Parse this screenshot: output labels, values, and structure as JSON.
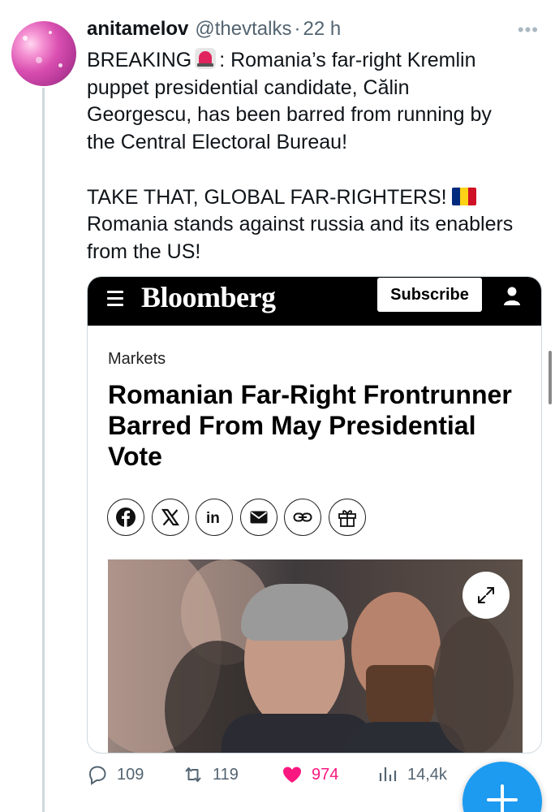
{
  "tweet": {
    "author_name": "anitamelov",
    "author_handle": "@thevtalks",
    "separator": "·",
    "time": "22 h",
    "more_icon": "more-horizontal-icon",
    "text_line1_a": "BREAKING",
    "text_line1_b": ": Romania’s far-right Kremlin",
    "text_line2": "puppet presidential candidate, Călin",
    "text_line3": "Georgescu, has been barred from running by",
    "text_line4": "the Central Electoral Bureau!",
    "text_line5": "TAKE THAT, GLOBAL FAR-RIGHTERS!",
    "text_line6": "Romania stands against russia and its enablers",
    "text_line7": "from the US!",
    "emoji_1": "siren-emoji",
    "emoji_2": "romania-flag-emoji",
    "flag_colors": [
      "#002b7f",
      "#fcd116",
      "#ce1126"
    ]
  },
  "card": {
    "brand": "Bloomberg",
    "subscribe_label": "Subscribe",
    "section": "Markets",
    "headline": "Romanian Far-Right Frontrunner Barred From May Presidential Vote",
    "share_icons": [
      "facebook-icon",
      "x-icon",
      "linkedin-icon",
      "email-icon",
      "link-icon",
      "gift-icon"
    ],
    "brand_bar_color": "#000000"
  },
  "metrics": {
    "replies": "109",
    "retweets": "119",
    "likes": "974",
    "views": "14,4k"
  },
  "colors": {
    "like": "#f91880",
    "accent": "#1d9bf0",
    "muted": "#536471"
  }
}
